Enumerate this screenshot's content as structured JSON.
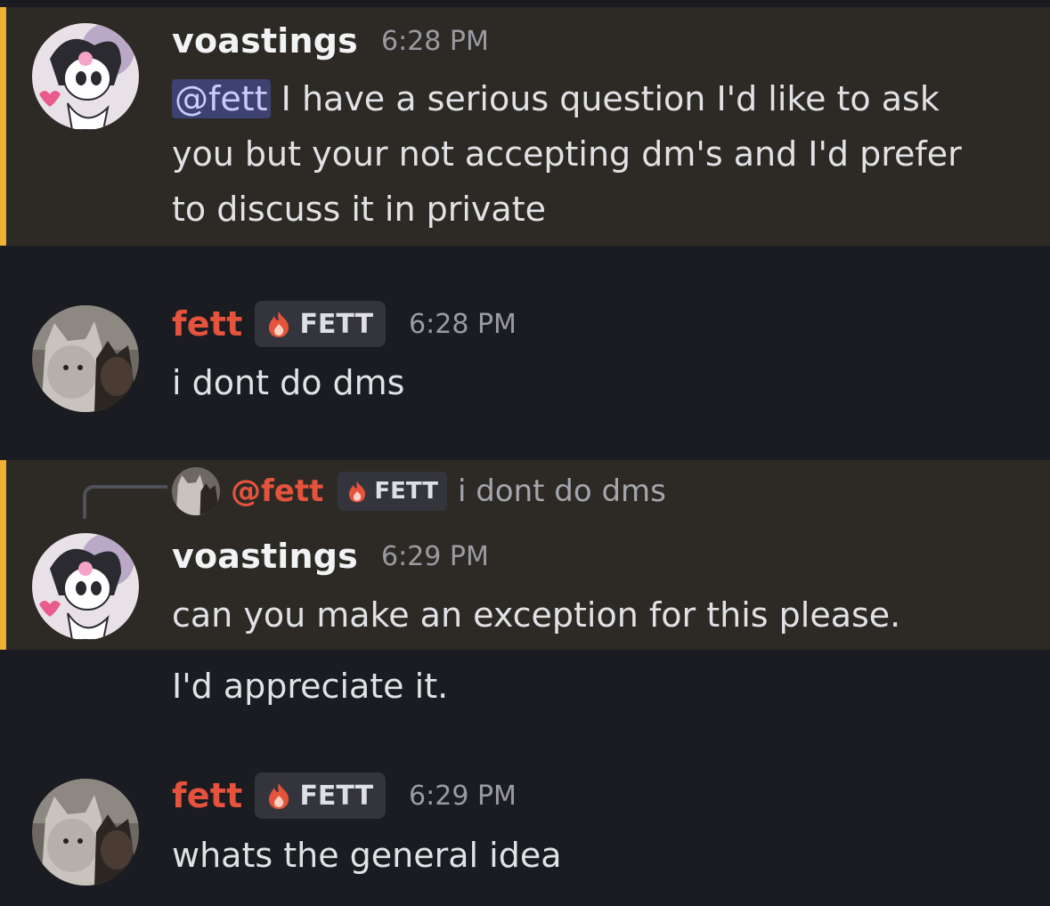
{
  "messages": [
    {
      "author": "voastings",
      "time": "6:28 PM",
      "mention": "@fett",
      "lines": [
        "I have a serious question I'd like to ask",
        "you but your not accepting dm's and I'd prefer",
        "to discuss it in private"
      ]
    },
    {
      "author": "fett",
      "tag": "FETT",
      "time": "6:28 PM",
      "text": "i dont do dms"
    },
    {
      "reply": {
        "mention": "@fett",
        "tag": "FETT",
        "text": "i dont do dms"
      },
      "author": "voastings",
      "time": "6:29 PM",
      "text": "can you make an exception for this please."
    },
    {
      "text": "I'd appreciate it."
    },
    {
      "author": "fett",
      "tag": "FETT",
      "time": "6:29 PM",
      "text": "whats the general idea"
    }
  ],
  "colors": {
    "background": "#1b1c21",
    "highlight": "#2d2a25",
    "highlight_bar": "#f0b232",
    "role_red": "#e5533d",
    "mention_bg": "#3d4270"
  },
  "icons": {
    "role_icon": "fire-icon",
    "avatar_voastings": "kuromi-avatar",
    "avatar_fett": "cats-avatar"
  }
}
